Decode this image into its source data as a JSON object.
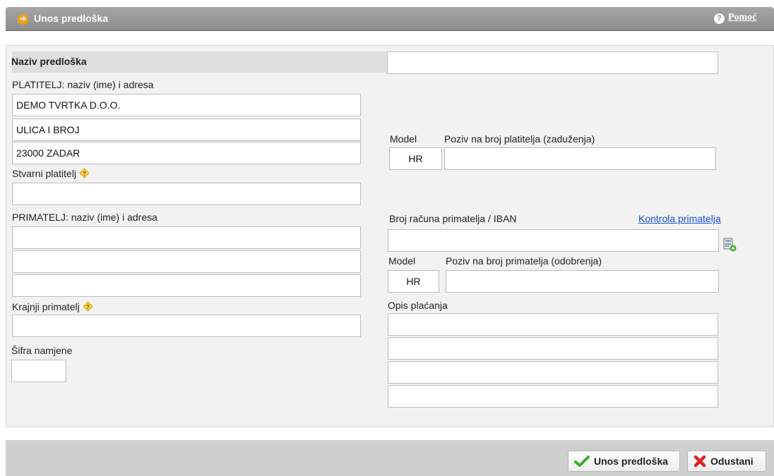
{
  "header": {
    "title": "Unos predloška",
    "help_label": "Pomoć"
  },
  "form": {
    "template_name_label": "Naziv predloška",
    "template_name_value": "",
    "payer": {
      "label": "PLATITELJ: naziv (ime) i adresa",
      "name": "DEMO TVRTKA D.O.O.",
      "street": "ULICA I BROJ",
      "city": "23000 ZADAR"
    },
    "actual_payer": {
      "label": "Stvarni platitelj",
      "value": ""
    },
    "payer_reference": {
      "model_label": "Model",
      "model_value": "HR",
      "label": "Poziv na broj platitelja (zaduženja)",
      "value": ""
    },
    "payee": {
      "label": "PRIMATELJ: naziv (ime) i adresa",
      "name": "",
      "street": "",
      "city": ""
    },
    "final_payee": {
      "label": "Krajnji primatelj",
      "value": ""
    },
    "purpose_code": {
      "label": "Šifra namjene",
      "value": ""
    },
    "payee_account": {
      "label": "Broj računa primatelja / IBAN",
      "value": "",
      "check_link": "Kontrola primatelja"
    },
    "payee_reference": {
      "model_label": "Model",
      "model_value": "HR",
      "label": "Poziv na broj primatelja (odobrenja)",
      "value": ""
    },
    "payment_description": {
      "label": "Opis plaćanja",
      "lines": [
        "",
        "",
        "",
        ""
      ]
    }
  },
  "footer": {
    "submit_label": "Unos predloška",
    "cancel_label": "Odustani"
  },
  "icons": [
    "arrow-right-icon",
    "help-icon",
    "question-icon",
    "calculator-add-icon",
    "check-icon",
    "x-icon"
  ],
  "colors": {
    "header_bg": "#9a9a9a",
    "panel_bg": "#f2f2f2",
    "link": "#1a4fd6",
    "accent_orange": "#f39c12",
    "check_green": "#3cae2a",
    "cancel_red": "#e02020"
  }
}
